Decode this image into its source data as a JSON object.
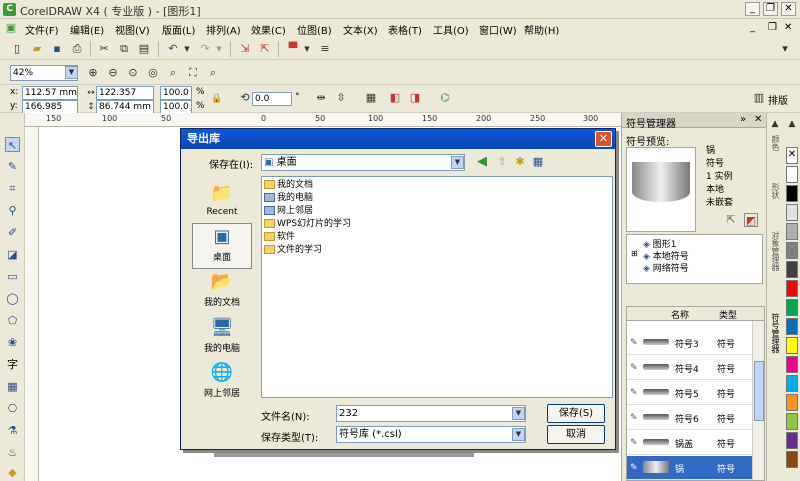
{
  "app": {
    "title": "CorelDRAW X4 ( 专业版 ) - [图形1]"
  },
  "window_buttons": [
    "_",
    "❐",
    "✕"
  ],
  "menu": [
    "文件(F)",
    "编辑(E)",
    "视图(V)",
    "版面(L)",
    "排列(A)",
    "效果(C)",
    "位图(B)",
    "文本(X)",
    "表格(T)",
    "工具(O)",
    "窗口(W)",
    "帮助(H)"
  ],
  "zoom": {
    "value": "42%"
  },
  "props": {
    "x_label": "x:",
    "x_value": "112.57 mm",
    "y_label": "y:",
    "y_value": "166.985 mm",
    "w_value": "122.357 mm",
    "h_value": "86.744 mm",
    "sx": "100.0",
    "sy": "100.0",
    "pct": "%",
    "angle": "0.0",
    "deg": "°",
    "arrange_label": "排版"
  },
  "ruler": {
    "ticks": [
      "150",
      "100",
      "50",
      "0",
      "50",
      "100",
      "150",
      "200",
      "250",
      "300"
    ]
  },
  "dialog": {
    "title": "导出库",
    "save_in_label": "保存在(I):",
    "save_in_value": "桌面",
    "places": [
      {
        "label": "Recent",
        "icon": "recent-folder-icon"
      },
      {
        "label": "桌面",
        "icon": "desktop-icon"
      },
      {
        "label": "我的文档",
        "icon": "my-documents-icon"
      },
      {
        "label": "我的电脑",
        "icon": "my-computer-icon"
      },
      {
        "label": "网上邻居",
        "icon": "network-icon"
      }
    ],
    "files": [
      "我的文档",
      "我的电脑",
      "网上邻居",
      "WPS幻灯片的学习",
      "软件",
      "文件的学习"
    ],
    "filename_label": "文件名(N):",
    "filename_value": "232",
    "filetype_label": "保存类型(T):",
    "filetype_value": "符号库 (*.csl)",
    "save_button": "保存(S)",
    "cancel_button": "取消"
  },
  "docker": {
    "title": "符号管理器",
    "preview_label": "符号预览:",
    "info": [
      "锅",
      "符号",
      "1 实例",
      "本地",
      "未嵌套"
    ],
    "tree": [
      "图形1",
      "本地符号",
      "网络符号"
    ],
    "col_name": "名称",
    "col_type": "类型",
    "rows": [
      {
        "name": "符号3",
        "type": "符号"
      },
      {
        "name": "符号4",
        "type": "符号"
      },
      {
        "name": "符号5",
        "type": "符号"
      },
      {
        "name": "符号6",
        "type": "符号"
      },
      {
        "name": "锅盖",
        "type": "符号"
      },
      {
        "name": "锅",
        "type": "符号"
      }
    ]
  },
  "side_tabs": [
    "颜色",
    "形状",
    "对象管理器",
    "符号管理器"
  ],
  "palette": [
    "#ffffff",
    "#000000",
    "#e0e0e0",
    "#b0b0b0",
    "#808080",
    "#404040",
    "#ff0000",
    "#00a651",
    "#0072bc",
    "#ffff00",
    "#ec008c",
    "#00aeef",
    "#f7941d",
    "#8dc63f",
    "#662d91",
    "#8b4513"
  ]
}
